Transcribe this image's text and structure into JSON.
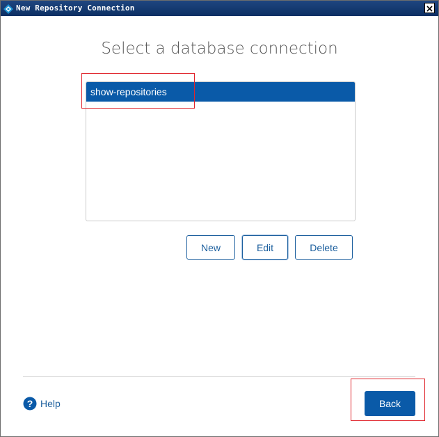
{
  "window": {
    "title": "New Repository Connection"
  },
  "dialog": {
    "heading": "Select a database connection"
  },
  "connections": {
    "items": [
      "show-repositories"
    ],
    "selected": "show-repositories"
  },
  "buttons": {
    "new_label": "New",
    "edit_label": "Edit",
    "delete_label": "Delete",
    "back_label": "Back"
  },
  "help": {
    "label": "Help"
  },
  "colors": {
    "accent": "#0a5aa8",
    "titlebar": "#0c2f63",
    "highlight_box": "#e0242b"
  },
  "icons": {
    "app": "diamond-app-icon",
    "close": "close-icon",
    "help": "question-circle-icon"
  }
}
